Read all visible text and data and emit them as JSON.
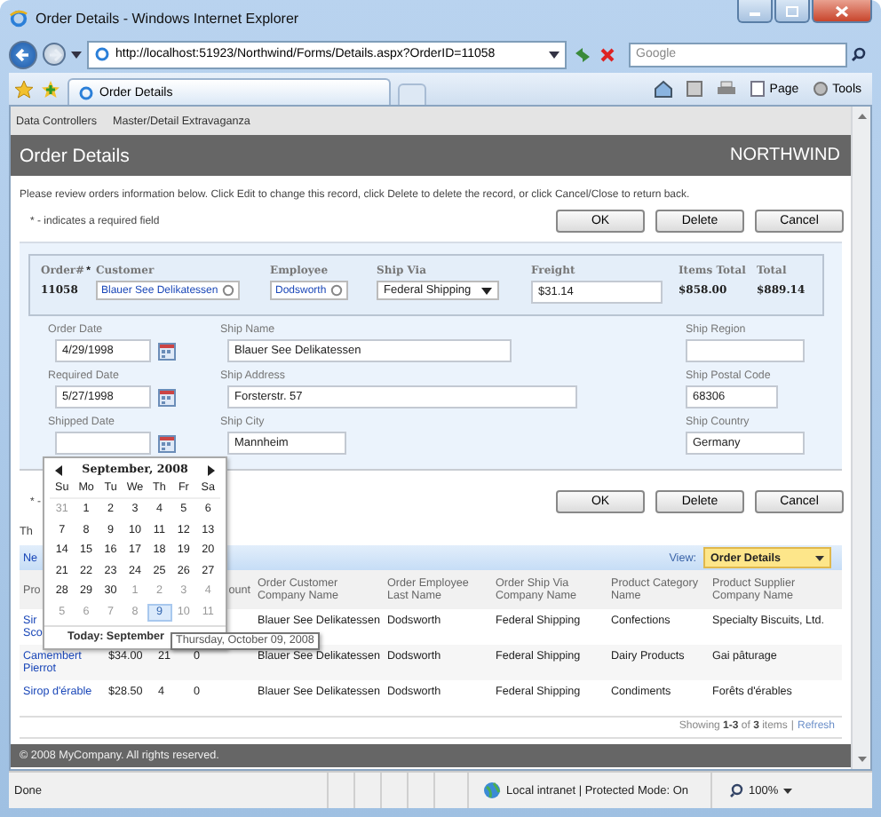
{
  "window": {
    "title": "Order Details - Windows Internet Explorer"
  },
  "address_bar": {
    "url": "http://localhost:51923/Northwind/Forms/Details.aspx?OrderID=11058"
  },
  "search": {
    "placeholder": "Google"
  },
  "browser_tab": {
    "label": "Order Details"
  },
  "command_bar": {
    "page": "Page",
    "tools": "Tools"
  },
  "site_menu": [
    "Data Controllers",
    "Master/Detail Extravaganza"
  ],
  "page_header": {
    "title": "Order Details",
    "brand": "NORTHWIND"
  },
  "instructions": "Please review orders information below. Click Edit to change this record, click Delete to delete the record, or click Cancel/Close to return back.",
  "required_note": "* - indicates a required field",
  "buttons": [
    "OK",
    "Delete",
    "Cancel"
  ],
  "summary": {
    "order_label": "Order#",
    "required_mark": "*",
    "order": "11058",
    "customer_label": "Customer",
    "customer": "Blauer See Delikatessen",
    "employee_label": "Employee",
    "employee": "Dodsworth",
    "ship_via_label": "Ship Via",
    "ship_via": "Federal Shipping",
    "freight_label": "Freight",
    "freight": "$31.14",
    "items_total_label": "Items Total",
    "items_total": "$858.00",
    "total_label": "Total",
    "total": "$889.14"
  },
  "date_fields": [
    {
      "label": "Order Date",
      "value": "4/29/1998"
    },
    {
      "label": "Required Date",
      "value": "5/27/1998"
    },
    {
      "label": "Shipped Date"
    }
  ],
  "ship_fields": [
    {
      "label": "Ship Name",
      "value": "Blauer See Delikatessen"
    },
    {
      "label": "Ship Address",
      "value": "Forsterstr. 57"
    },
    {
      "label": "Ship City",
      "value": "Mannheim"
    }
  ],
  "region_fields": [
    {
      "label": "Ship Region"
    },
    {
      "label": "Ship Postal Code",
      "value": "68306"
    },
    {
      "label": "Ship Country",
      "value": "Germany"
    }
  ],
  "bottom_note_fragment": "* -",
  "bottom_buttons": [
    "OK",
    "Delete",
    "Cancel"
  ],
  "details_fragment": "Th",
  "grid": {
    "new_fragment": "Ne",
    "view_label": "View:",
    "view": "Order Details",
    "columns": {
      "product": "Pro",
      "discount": "ount",
      "customer": "Order Customer Company Name",
      "employee": "Order Employee Last Name",
      "ship_via": "Order Ship Via Company Name",
      "category": "Product Category Name",
      "supplier": "Product Supplier Company Name"
    },
    "rows": [
      {
        "product": [
          "Sir",
          "Sco"
        ],
        "customer": "Blauer See Delikatessen",
        "employee": "Dodsworth",
        "ship_via": "Federal Shipping",
        "category": "Confections",
        "supplier": "Specialty Biscuits, Ltd."
      },
      {
        "product": [
          "Camembert",
          "Pierrot"
        ],
        "unit_price": "$34.00",
        "quantity": "21",
        "discount": "0",
        "customer": "Blauer See Delikatessen",
        "employee": "Dodsworth",
        "ship_via": "Federal Shipping",
        "category": "Dairy Products",
        "supplier": "Gai pâturage"
      },
      {
        "product": [
          "Sirop d'érable"
        ],
        "unit_price": "$28.50",
        "quantity": "4",
        "discount": "0",
        "customer": "Blauer See Delikatessen",
        "employee": "Dodsworth",
        "ship_via": "Federal Shipping",
        "category": "Condiments",
        "supplier": "Forêts d'érables"
      }
    ],
    "pager": "Showing **1-3** of **3** items",
    "pager_separator": "|",
    "refresh": "Refresh"
  },
  "calendar": {
    "month": "September, 2008",
    "day_names": [
      "Su",
      "Mo",
      "Tu",
      "We",
      "Th",
      "Fr",
      "Sa"
    ],
    "weeks": [
      [
        {
          "d": "31",
          "other": true,
          "hover": false
        },
        {
          "d": "1",
          "other": false,
          "hover": false
        },
        {
          "d": "2",
          "other": false,
          "hover": false
        },
        {
          "d": "3",
          "other": false,
          "hover": false
        },
        {
          "d": "4",
          "other": false,
          "hover": false
        },
        {
          "d": "5",
          "other": false,
          "hover": false
        },
        {
          "d": "6",
          "other": false,
          "hover": false
        }
      ],
      [
        {
          "d": "7",
          "other": false,
          "hover": false
        },
        {
          "d": "8",
          "other": false,
          "hover": false
        },
        {
          "d": "9",
          "other": false,
          "hover": false
        },
        {
          "d": "10",
          "other": false,
          "hover": false
        },
        {
          "d": "11",
          "other": false,
          "hover": false
        },
        {
          "d": "12",
          "other": false,
          "hover": false
        },
        {
          "d": "13",
          "other": false,
          "hover": false
        }
      ],
      [
        {
          "d": "14",
          "other": false,
          "hover": false
        },
        {
          "d": "15",
          "other": false,
          "hover": false
        },
        {
          "d": "16",
          "other": false,
          "hover": false
        },
        {
          "d": "17",
          "other": false,
          "hover": false
        },
        {
          "d": "18",
          "other": false,
          "hover": false
        },
        {
          "d": "19",
          "other": false,
          "hover": false
        },
        {
          "d": "20",
          "other": false,
          "hover": false
        }
      ],
      [
        {
          "d": "21",
          "other": false,
          "hover": false
        },
        {
          "d": "22",
          "other": false,
          "hover": false
        },
        {
          "d": "23",
          "other": false,
          "hover": false
        },
        {
          "d": "24",
          "other": false,
          "hover": false
        },
        {
          "d": "25",
          "other": false,
          "hover": false
        },
        {
          "d": "26",
          "other": false,
          "hover": false
        },
        {
          "d": "27",
          "other": false,
          "hover": false
        }
      ],
      [
        {
          "d": "28",
          "other": false,
          "hover": false
        },
        {
          "d": "29",
          "other": false,
          "hover": false
        },
        {
          "d": "30",
          "other": false,
          "hover": false
        },
        {
          "d": "1",
          "other": true,
          "hover": false
        },
        {
          "d": "2",
          "other": true,
          "hover": false
        },
        {
          "d": "3",
          "other": true,
          "hover": false
        },
        {
          "d": "4",
          "other": true,
          "hover": false
        }
      ],
      [
        {
          "d": "5",
          "other": true,
          "hover": false
        },
        {
          "d": "6",
          "other": true,
          "hover": false
        },
        {
          "d": "7",
          "other": true,
          "hover": false
        },
        {
          "d": "8",
          "other": true,
          "hover": false
        },
        {
          "d": "9",
          "other": true,
          "hover": true
        },
        {
          "d": "10",
          "other": true,
          "hover": false
        },
        {
          "d": "11",
          "other": true,
          "hover": false
        }
      ]
    ],
    "today": "Today: September",
    "tooltip": "Thursday, October 09, 2008"
  },
  "footer": "© 2008 MyCompany. All rights reserved.",
  "status_bar": {
    "text": "Done",
    "zone": "Local intranet | Protected Mode: On",
    "zoom": "100%"
  }
}
